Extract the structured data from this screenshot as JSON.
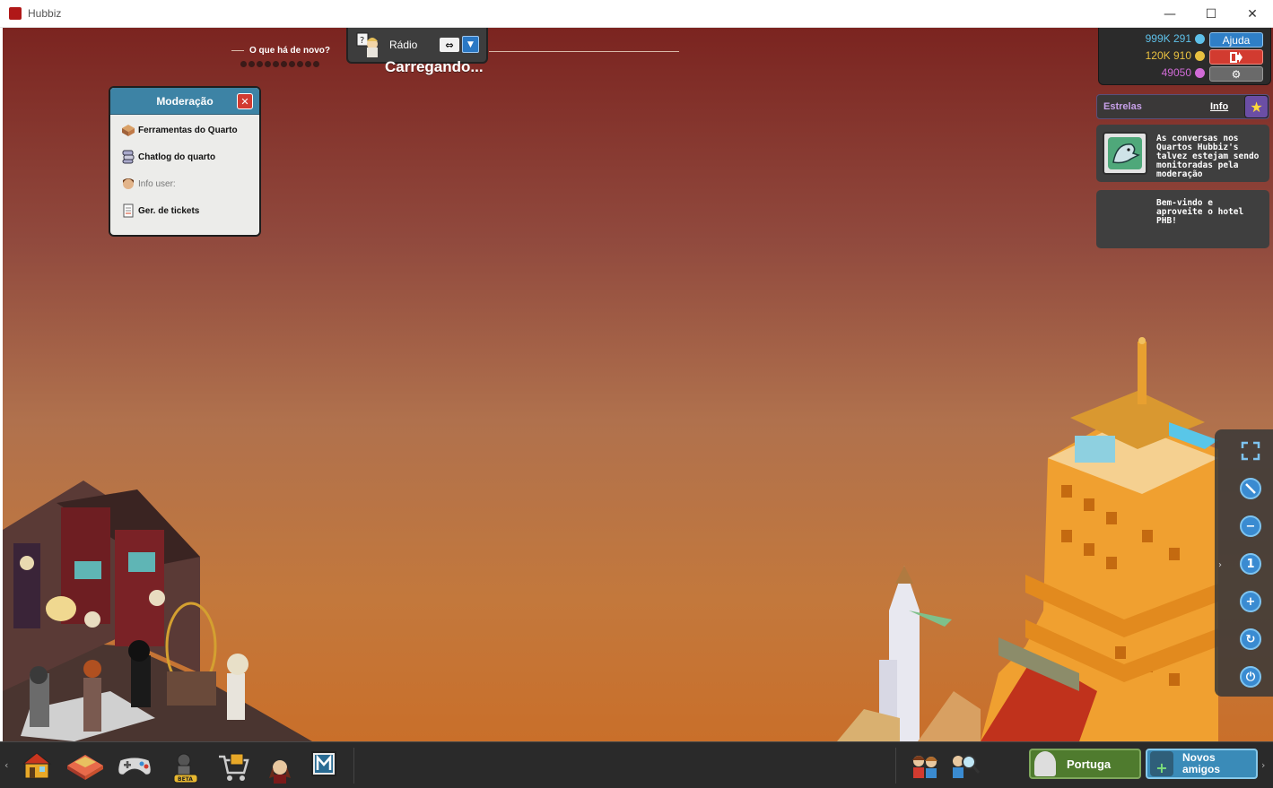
{
  "window": {
    "title": "Hubbiz",
    "controls": {
      "minimize": "—",
      "maximize": "☐",
      "close": "✕"
    }
  },
  "news": {
    "label": "O que há de novo?",
    "dot_count": 10
  },
  "radio": {
    "label": "Rádio",
    "arrows_glyph": "⇔",
    "dropdown_glyph": "▼"
  },
  "loading_text": "Carregando...",
  "moderation": {
    "title": "Moderação",
    "close_glyph": "✕",
    "items": [
      {
        "label": "Ferramentas do Quarto",
        "icon": "room-tools-icon",
        "enabled": true
      },
      {
        "label": "Chatlog do quarto",
        "icon": "chatlog-icon",
        "enabled": true
      },
      {
        "label": "Info user:",
        "icon": "user-info-icon",
        "enabled": false
      },
      {
        "label": "Ger. de tickets",
        "icon": "tickets-icon",
        "enabled": true
      }
    ]
  },
  "currency": {
    "diamonds": "999K 291",
    "credits": "120K 910",
    "points": "49050",
    "colors": {
      "diamonds": "#5ec0e8",
      "credits": "#e8c040",
      "points": "#d06bd6"
    },
    "help_label": "Ajuda",
    "logout_icon": "logout-icon",
    "settings_icon": "gear-icon"
  },
  "stars": {
    "label": "Estrelas",
    "info_label": "Info",
    "icon": "star-icon"
  },
  "notifications": [
    {
      "text": "As conversas nos Quartos Hubbiz's talvez estejam sendo monitoradas pela moderação",
      "icon": "moderator-shark-icon"
    },
    {
      "text": "Bem-vindo e aproveite o hotel PHB!"
    }
  ],
  "zoom_toolbar": {
    "buttons": [
      "fullscreen-icon",
      "block-icon",
      "zoom-out-icon",
      "zoom-reset-icon",
      "zoom-in-icon",
      "rotate-icon",
      "power-icon"
    ],
    "reset_label": "1"
  },
  "bottom_bar": {
    "left_arrow": "‹",
    "right_arrow": "›",
    "items": [
      "home-icon",
      "room-icon",
      "games-icon",
      "beta-robot-icon",
      "shop-icon",
      "avatar-icon",
      "m-icon"
    ],
    "friends_icons": [
      "friends-icon",
      "search-friends-icon"
    ],
    "room_label": "Portuga",
    "new_friends_label": "Novos amigos"
  }
}
